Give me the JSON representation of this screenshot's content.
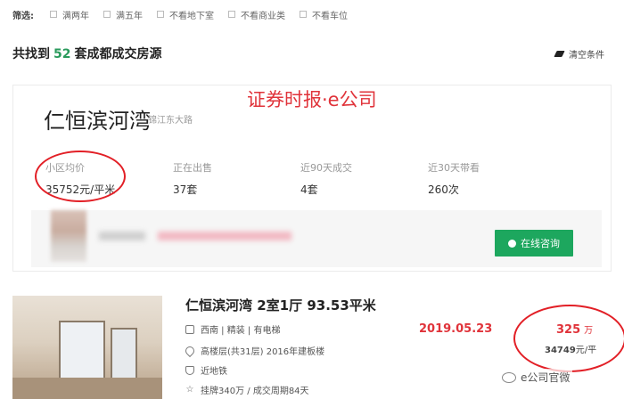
{
  "filters": {
    "label": "筛选:",
    "options": [
      "满两年",
      "满五年",
      "不看地下室",
      "不看商业类",
      "不看车位"
    ]
  },
  "summary": {
    "prefix": "共找到",
    "count": "52",
    "suffix": "套成都成交房源"
  },
  "clear_label": "清空条件",
  "community": {
    "name": "仁恒滨河湾",
    "road": "锦江东大路",
    "stats": [
      {
        "label": "小区均价",
        "value": "35752元/平米"
      },
      {
        "label": "正在出售",
        "value": "37套"
      },
      {
        "label": "近90天成交",
        "value": "4套"
      },
      {
        "label": "近30天带看",
        "value": "260次"
      }
    ],
    "chat_button": "在线咨询"
  },
  "watermark": "证券时报·e公司",
  "listing": {
    "title": "仁恒滨河湾 2室1厅 93.53平米",
    "rows": [
      {
        "icon": "house-icon",
        "text": "西南 | 精装 | 有电梯"
      },
      {
        "icon": "location-pin-icon",
        "text": "高楼层(共31层) 2016年建板楼"
      },
      {
        "icon": "shield-icon",
        "text": "近地铁"
      },
      {
        "icon": "star-icon",
        "text": "挂牌340万 / 成交周期84天"
      }
    ],
    "deal_date": "2019.05.23",
    "price": "325",
    "price_unit": "万",
    "unit_price_value": "34749",
    "unit_price_unit": "元/平"
  },
  "wechat_mark": "e公司官微",
  "colors": {
    "accent_green": "#2a9a5c",
    "button_green": "#1da75e",
    "annotation_red": "#e21f26"
  }
}
